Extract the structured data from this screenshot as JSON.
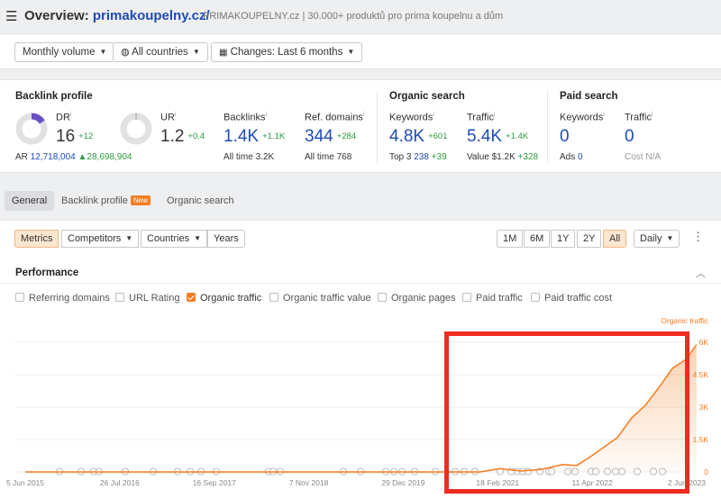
{
  "header": {
    "title_prefix": "Overview: ",
    "site": "primakoupelny.cz/",
    "subtitle": "PRIMAKOUPELNY.cz | 30.000+ produktů pro prima koupelnu a dům"
  },
  "filters": {
    "volume": "Monthly volume",
    "countries": "All countries",
    "changes": "Changes: Last 6 months"
  },
  "backlink_profile": {
    "title": "Backlink profile",
    "dr": {
      "label": "DR",
      "value": "16",
      "delta": "+12"
    },
    "dr_ar": {
      "label": "AR",
      "value": "12,718,004",
      "delta": "▲28,698,904"
    },
    "ur": {
      "label": "UR",
      "value": "1.2",
      "delta": "+0.4"
    },
    "backlinks": {
      "label": "Backlinks",
      "value": "1.4K",
      "delta": "+1.1K",
      "sub_label": "All time",
      "sub_value": "3.2K"
    },
    "ref_domains": {
      "label": "Ref. domains",
      "value": "344",
      "delta": "+284",
      "sub_label": "All time",
      "sub_value": "768"
    }
  },
  "organic_search": {
    "title": "Organic search",
    "keywords": {
      "label": "Keywords",
      "value": "4.8K",
      "delta": "+601",
      "sub_label": "Top 3",
      "sub_value": "238",
      "sub_delta": "+39"
    },
    "traffic": {
      "label": "Traffic",
      "value": "5.4K",
      "delta": "+1.4K",
      "sub_label": "Value",
      "sub_value": "$1.2K",
      "sub_delta": "+328"
    }
  },
  "paid_search": {
    "title": "Paid search",
    "keywords": {
      "label": "Keywords",
      "value": "0",
      "sub_label": "Ads",
      "sub_value": "0"
    },
    "traffic": {
      "label": "Traffic",
      "value": "0",
      "sub_label": "Cost",
      "sub_value": "N/A"
    }
  },
  "tabs": {
    "general": "General",
    "backlink_profile": "Backlink profile",
    "new_badge": "New",
    "organic_search": "Organic search"
  },
  "chart_controls": {
    "metrics": "Metrics",
    "competitors": "Competitors",
    "countries": "Countries",
    "years": "Years",
    "ranges": [
      "1M",
      "6M",
      "1Y",
      "2Y",
      "All"
    ],
    "granularity": "Daily"
  },
  "performance": {
    "title": "Performance",
    "checkboxes": {
      "referring_domains": "Referring domains",
      "url_rating": "URL Rating",
      "organic_traffic": "Organic traffic",
      "organic_traffic_value": "Organic traffic value",
      "organic_pages": "Organic pages",
      "paid_traffic": "Paid traffic",
      "paid_traffic_cost": "Paid traffic cost"
    }
  },
  "colors": {
    "accent": "#f47c20",
    "link": "#1e4db7",
    "positive": "#2e9b3e",
    "highlight": "#ee2c21"
  },
  "chart_data": {
    "type": "area",
    "series": [
      {
        "name": "Organic traffic",
        "color": "#f47c20"
      }
    ],
    "ylabel": "Organic traffic",
    "y_ticks": [
      "6K",
      "4.5K",
      "3K",
      "1.5K",
      "0"
    ],
    "ylim": [
      0,
      6500
    ],
    "x_ticks": [
      "5 Jun 2015",
      "26 Jul 2016",
      "16 Sep 2017",
      "7 Nov 2018",
      "29 Dec 2019",
      "18 Feb 2021",
      "11 Apr 2022",
      "2 Jun 2023"
    ],
    "x": [
      "2015-06-05",
      "2020-12-01",
      "2021-03-01",
      "2021-06-01",
      "2021-09-01",
      "2021-12-01",
      "2022-02-01",
      "2022-04-01",
      "2022-06-01",
      "2022-08-01",
      "2022-10-01",
      "2022-12-01",
      "2023-02-01",
      "2023-04-01",
      "2023-06-01",
      "2023-07-15"
    ],
    "y": [
      0,
      0,
      50,
      100,
      150,
      250,
      400,
      650,
      1100,
      1700,
      2400,
      3100,
      4000,
      4700,
      5300,
      5900
    ],
    "legend": "top-right",
    "grid": true
  }
}
